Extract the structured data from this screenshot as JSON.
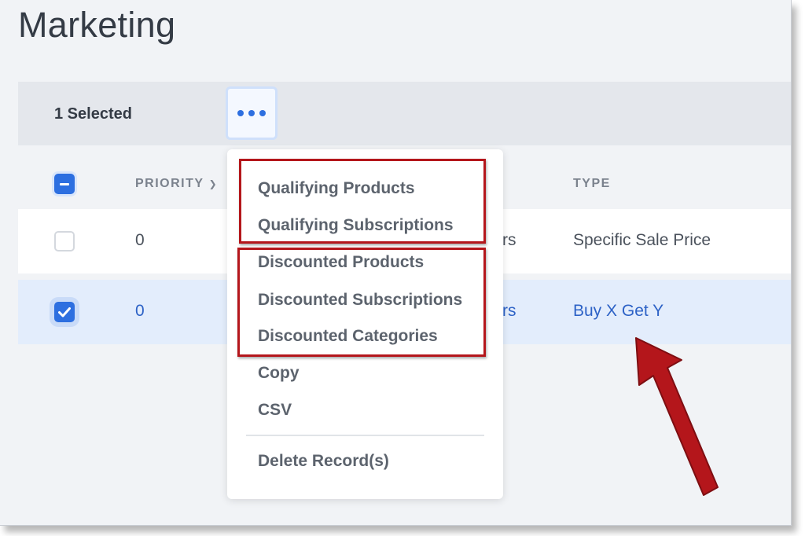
{
  "page": {
    "title": "Marketing"
  },
  "bulk_bar": {
    "selected_label": "1 Selected",
    "more_icon": "ellipsis-icon"
  },
  "table": {
    "headers": {
      "priority": "PRIORITY",
      "type": "TYPE"
    },
    "rows": [
      {
        "priority": "0",
        "col_partial": "rs",
        "type": "Specific Sale Price",
        "checked": false
      },
      {
        "priority": "0",
        "col_partial": "rs",
        "type": "Buy X Get Y",
        "checked": true
      }
    ]
  },
  "menu": {
    "items": [
      "Qualifying Products",
      "Qualifying Subscriptions",
      "Discounted Products",
      "Discounted Subscriptions",
      "Discounted Categories",
      "Copy",
      "CSV",
      "Delete Record(s)"
    ]
  },
  "colors": {
    "accent": "#2d6fe0",
    "highlight": "#b4161b",
    "selected_row": "#e3edfc"
  },
  "annotations": {
    "arrow_icon": "red-arrow-icon"
  }
}
